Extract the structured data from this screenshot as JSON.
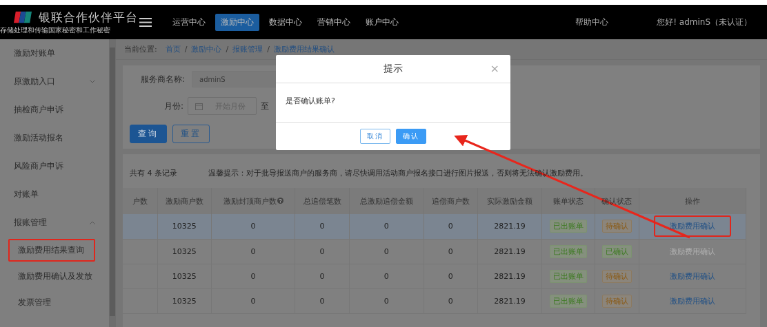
{
  "header": {
    "title": "银联合作伙伴平台",
    "subtitle": "存储处理和传输国家秘密和工作秘密",
    "nav": [
      {
        "label": "运营中心",
        "selected": false
      },
      {
        "label": "激励中心",
        "selected": true
      },
      {
        "label": "数据中心",
        "selected": false
      },
      {
        "label": "营销中心",
        "selected": false
      },
      {
        "label": "账户中心",
        "selected": false
      }
    ],
    "help": "帮助中心",
    "user": "您好! adminS（未认证）"
  },
  "sidebar": {
    "items": [
      {
        "label": "激励对账单"
      },
      {
        "label": "原激励入口",
        "expanded": false
      },
      {
        "label": "抽检商户申诉"
      },
      {
        "label": "激励活动报名"
      },
      {
        "label": "风险商户申诉"
      },
      {
        "label": "对账单"
      },
      {
        "label": "报账管理",
        "expanded": true,
        "children": [
          {
            "label": "激励费用结果查询",
            "highlighted": true
          },
          {
            "label": "激励费用确认及发放",
            "highlighted": false
          },
          {
            "label": "发票管理",
            "highlighted": false
          }
        ]
      }
    ]
  },
  "breadcrumb": {
    "label": "当前位置:",
    "separator": "/",
    "items": [
      "首页",
      "激励中心",
      "报账管理",
      "激励费用结果确认"
    ]
  },
  "filters": {
    "provider_label": "服务商名称:",
    "provider_value": "adminS",
    "month_label": "月份:",
    "month_start_placeholder": "开始月份",
    "month_to": "至",
    "buttons": [
      "查询",
      "重置"
    ]
  },
  "summary": {
    "count": "共有 4 条记录",
    "notice": "温馨提示：对于批导报送商户的服务商，请尽快调用活动商户报名接口进行图片报送，否则将无法确认激励费用。"
  },
  "table": {
    "columns": [
      "户数",
      "激励商户数",
      "激励封顶商户数",
      "总追偿笔数",
      "总激励追偿金额",
      "追偿商户数",
      "实际激励金额",
      "账单状态",
      "确认状态",
      "操作"
    ],
    "rows": [
      {
        "selected": true,
        "cells": [
          "",
          "10325",
          "0",
          "0",
          "0",
          "0",
          "2821.19"
        ],
        "bill_status": "已出账单",
        "confirm_status": {
          "kind": "pending",
          "label": "待确认"
        },
        "action": {
          "label": "激励费用确认",
          "disabled": false,
          "highlighted": true
        }
      },
      {
        "selected": false,
        "cells": [
          "",
          "10325",
          "0",
          "0",
          "0",
          "0",
          "2821.19"
        ],
        "bill_status": "已出账单",
        "confirm_status": {
          "kind": "confirmed",
          "label": "已确认"
        },
        "action": {
          "label": "激励费用确认",
          "disabled": true,
          "highlighted": false
        }
      },
      {
        "selected": false,
        "cells": [
          "",
          "10325",
          "0",
          "0",
          "0",
          "0",
          "2821.19"
        ],
        "bill_status": "已出账单",
        "confirm_status": {
          "kind": "pending",
          "label": "待确认"
        },
        "action": {
          "label": "激励费用确认",
          "disabled": false,
          "highlighted": false
        }
      },
      {
        "selected": false,
        "cells": [
          "",
          "10325",
          "0",
          "0",
          "0",
          "0",
          "2821.19"
        ],
        "bill_status": "已出账单",
        "confirm_status": {
          "kind": "pending",
          "label": "待确认"
        },
        "action": {
          "label": "激励费用确认",
          "disabled": false,
          "highlighted": false
        }
      }
    ]
  },
  "dialog": {
    "title": "提示",
    "close": "×",
    "message": "是否确认账单?",
    "buttons": [
      {
        "kind": "secondary",
        "label": "取消"
      },
      {
        "kind": "primary",
        "label": "确认"
      }
    ]
  }
}
